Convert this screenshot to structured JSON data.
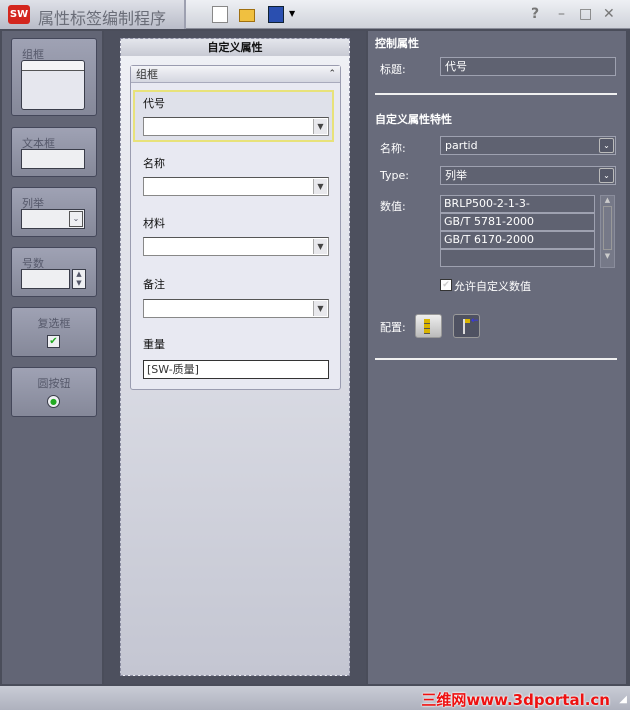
{
  "app": {
    "title": "属性标签编制程序",
    "logo": "SW"
  },
  "toolbar": {
    "icons": [
      "new-document-icon",
      "open-folder-icon",
      "save-icon"
    ],
    "help": "?",
    "minimize": "–",
    "maximize": "□",
    "close": "✕"
  },
  "toolbox": {
    "items": [
      {
        "label": "组框"
      },
      {
        "label": "文本框"
      },
      {
        "label": "列举"
      },
      {
        "label": "号数"
      },
      {
        "label": "复选框"
      },
      {
        "label": "圆按钮"
      }
    ]
  },
  "form": {
    "title": "自定义属性",
    "group_label": "组框",
    "fields": [
      {
        "label": "代号",
        "value": ""
      },
      {
        "label": "名称",
        "value": ""
      },
      {
        "label": "材料",
        "value": ""
      },
      {
        "label": "备注",
        "value": ""
      }
    ],
    "weight_label": "重量",
    "weight_value": "[SW-质量]"
  },
  "properties": {
    "control_header": "控制属性",
    "title_label": "标题:",
    "title_value": "代号",
    "custom_header": "自定义属性特性",
    "name_label": "名称:",
    "name_value": "partid",
    "type_label": "Type:",
    "type_value": "列举",
    "values_label": "数值:",
    "values": [
      "BRLP500-2-1-3-",
      "GB/T 5781-2000",
      "GB/T 6170-2000",
      ""
    ],
    "allow_custom_label": "允许自定义数值",
    "allow_custom_checked": true,
    "config_label": "配置:"
  },
  "status": {
    "watermark": "三维网www.3dportal.cn"
  }
}
